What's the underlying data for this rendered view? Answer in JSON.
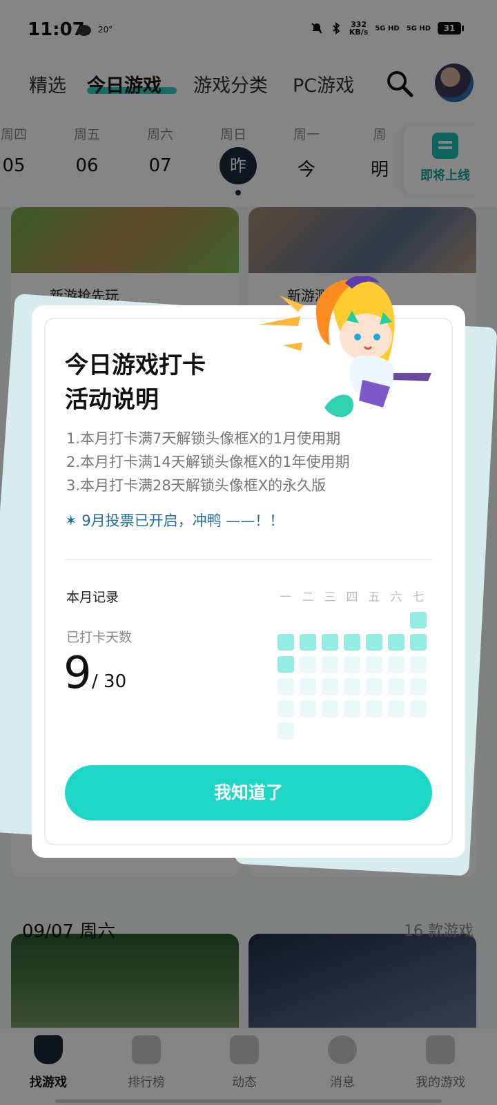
{
  "status": {
    "time": "11:07",
    "temp": "20°",
    "speed_value": "332",
    "speed_unit": "KB/s",
    "net1": "5G HD",
    "net2": "5G HD",
    "battery": "31"
  },
  "nav": {
    "tabs": [
      "精选",
      "今日游戏",
      "游戏分类",
      "PC游戏"
    ],
    "active_index": 1
  },
  "dates": [
    {
      "week": "周四",
      "num": "05"
    },
    {
      "week": "周五",
      "num": "06"
    },
    {
      "week": "周六",
      "num": "07"
    },
    {
      "week": "周日",
      "num": "昨"
    },
    {
      "week": "周一",
      "num": "今"
    },
    {
      "week": "周",
      "num": "明"
    }
  ],
  "upcoming_label": "即将上线",
  "feed": {
    "card1_tag": "新游抢先玩",
    "card2_tag": "新游测试招募",
    "section_date": "09/07 周六",
    "section_count": "16 款游戏"
  },
  "bottom_nav": {
    "items": [
      "找游戏",
      "排行榜",
      "动态",
      "消息",
      "我的游戏"
    ],
    "active_index": 0
  },
  "modal": {
    "title_line1": "今日游戏打卡",
    "title_line2": "活动说明",
    "rules": [
      "1.本月打卡满7天解锁头像框Ⅹ的1月使用期",
      "2.本月打卡满14天解锁头像框Ⅹ的1年使用期",
      "3.本月打卡满28天解锁头像框Ⅹ的永久版"
    ],
    "vote_note": "✶ 9月投票已开启，冲鸭 ——！！",
    "record_label": "本月记录",
    "days_label": "已打卡天数",
    "checked_days": "9",
    "total_days": "/ 30",
    "week_headers": [
      "一",
      "二",
      "三",
      "四",
      "五",
      "六",
      "七"
    ],
    "calendar": {
      "first_weekday_index": 6,
      "days_in_month": 30,
      "checked_count": 9
    },
    "cta_label": "我知道了"
  },
  "colors": {
    "accent": "#1dd6c6",
    "checked_cell": "#95ebe3",
    "unchecked_cell": "#eafaf8",
    "note_blue": "#1f6a9e"
  }
}
